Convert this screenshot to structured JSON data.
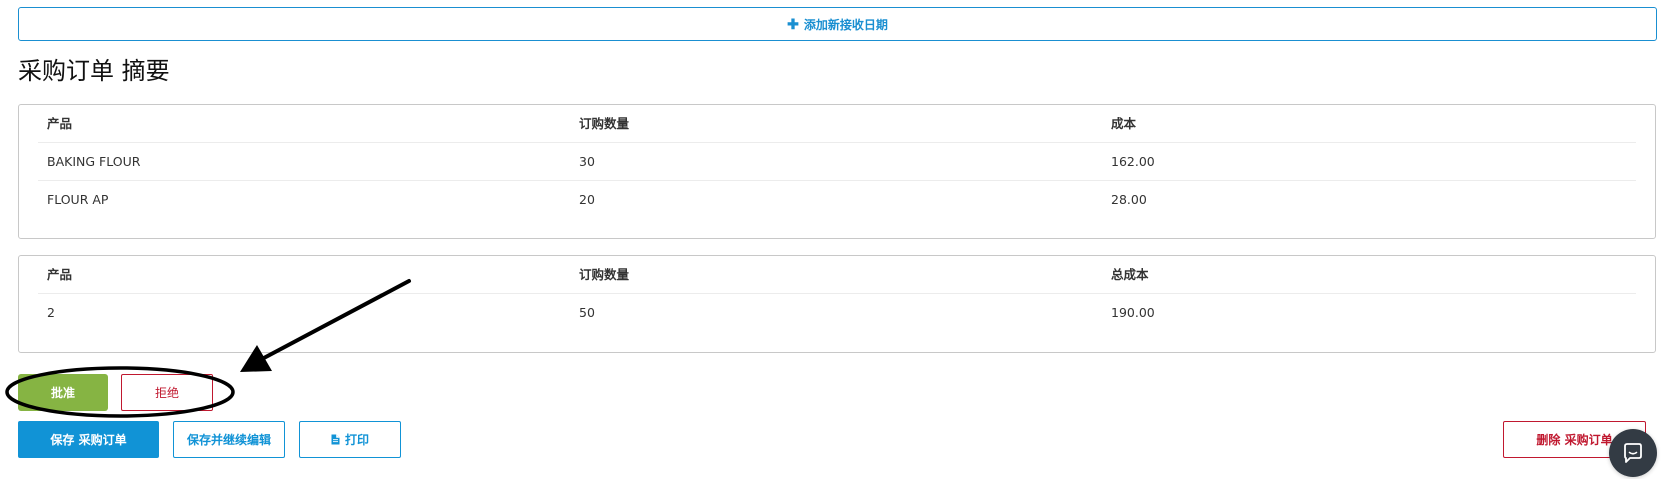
{
  "add_receive_date": {
    "label": "添加新接收日期",
    "icon": "plus-icon"
  },
  "summary": {
    "title": "采购订单 摘要"
  },
  "items_table": {
    "headers": [
      "产品",
      "订购数量",
      "成本"
    ],
    "rows": [
      [
        "BAKING FLOUR",
        "30",
        "162.00"
      ],
      [
        "FLOUR AP",
        "20",
        "28.00"
      ]
    ]
  },
  "totals_table": {
    "headers": [
      "产品",
      "订购数量",
      "总成本"
    ],
    "rows": [
      [
        "2",
        "50",
        "190.00"
      ]
    ]
  },
  "actions": {
    "approve": "批准",
    "reject": "拒绝",
    "save": "保存 采购订单",
    "save_continue": "保存并继续编辑",
    "print": "打印",
    "print_icon": "document-icon",
    "delete": "删除 采购订单"
  },
  "colors": {
    "accent": "#1193d6",
    "approve": "#86b443",
    "danger": "#c0182f",
    "chat": "#333b44"
  },
  "annotation": {
    "icon": "arrow-icon"
  }
}
